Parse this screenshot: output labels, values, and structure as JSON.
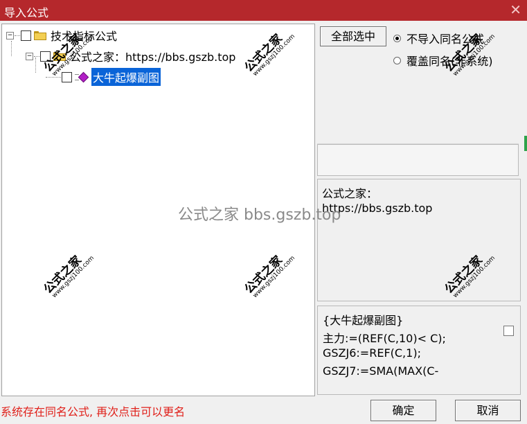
{
  "window": {
    "title": "导入公式",
    "close_glyph": "✕"
  },
  "tree": {
    "root": {
      "label": "技术指标公式",
      "expander": "−"
    },
    "group": {
      "label": "公式之家：https://bbs.gszb.top",
      "expander": "−"
    },
    "item": {
      "label": "大牛起爆副图"
    }
  },
  "options": {
    "select_all_label": "全部选中",
    "radio_skip_label": "不导入同名公式",
    "radio_overwrite_label": "覆盖同名(非系统)",
    "selected": "radio_skip"
  },
  "description": {
    "line1": "公式之家：",
    "line2": "https://bbs.gszb.top"
  },
  "code": {
    "lines": [
      "{大牛起爆副图}",
      "主力:=(REF(C,10)< C);",
      "GSZJ6:=REF(C,1);",
      "GSZJ7:=SMA(MAX(C-"
    ]
  },
  "status_text": "系统存在同名公式, 再次点击可以更名",
  "buttons": {
    "ok": "确定",
    "cancel": "取消"
  },
  "watermark": {
    "text": "公式之家",
    "url": "www.gszj100.com",
    "center": "公式之家 bbs.gszb.top"
  },
  "colors": {
    "title_bar": "#b5282c",
    "selection": "#0a64d8",
    "status_text": "#e0201a"
  }
}
